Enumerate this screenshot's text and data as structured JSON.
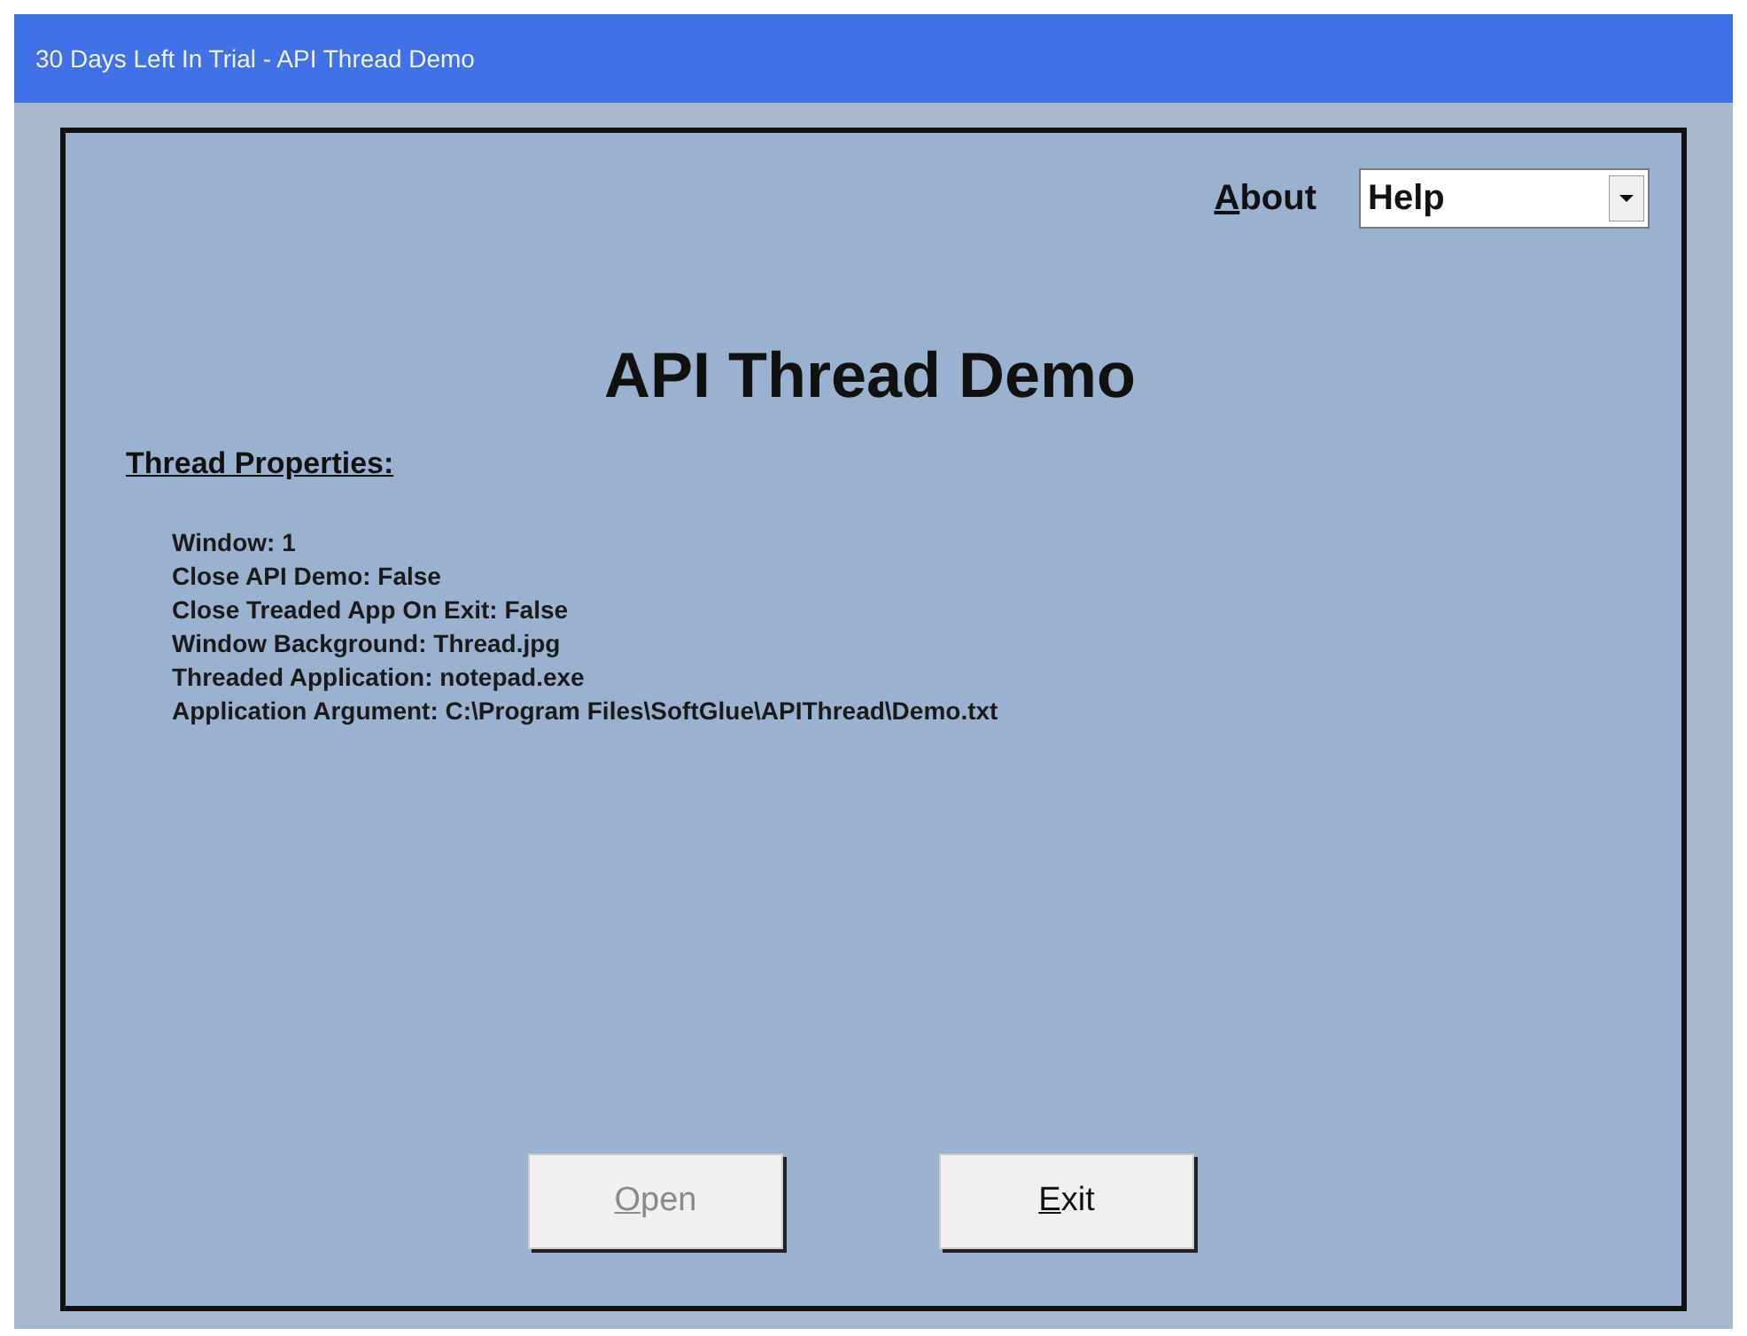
{
  "window": {
    "title": "30 Days Left In Trial - API Thread Demo"
  },
  "about": {
    "key": "A",
    "rest": "bout"
  },
  "dropdown": {
    "value": "Help"
  },
  "heading": "API Thread Demo",
  "section_title": "Thread Properties:",
  "properties": [
    "Window: 1",
    "Close API Demo: False",
    "Close Treaded App On Exit: False",
    "Window Background: Thread.jpg",
    "Threaded Application: notepad.exe",
    "Application Argument: C:\\Program Files\\SoftGlue\\APIThread\\Demo.txt"
  ],
  "buttons": [
    {
      "key": "O",
      "rest": "pen",
      "disabled": true
    },
    {
      "key": "E",
      "rest": "xit",
      "disabled": false
    }
  ]
}
